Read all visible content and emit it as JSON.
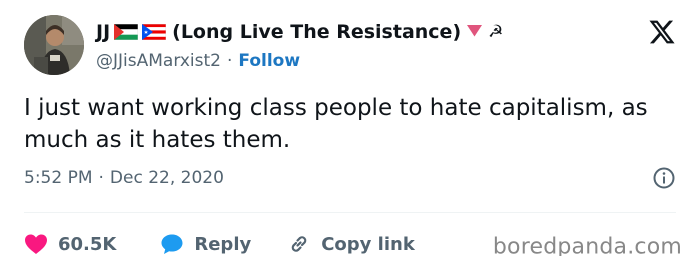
{
  "tweet": {
    "author": {
      "display_name_prefix": "JJ",
      "display_name_suffix": "(Long Live The Resistance)",
      "emoji_heart": "🔻",
      "emoji_symbol": "☭",
      "flags": [
        "palestine-flag-icon",
        "puerto-rico-flag-icon"
      ],
      "handle": "@JJisAMarxist2",
      "separator": "·",
      "follow_label": "Follow"
    },
    "text": "I just want working class people to hate capitalism, as much as it hates them.",
    "time": "5:52 PM",
    "meta_separator": "·",
    "date": "Dec 22, 2020",
    "actions": {
      "like_count": "60.5K",
      "reply_label": "Reply",
      "copy_link_label": "Copy link"
    }
  },
  "watermark": "boredpanda.com",
  "colors": {
    "text_primary": "#0f1419",
    "text_secondary": "#536471",
    "follow_blue": "#1d77c2",
    "like_red": "#f91880",
    "reply_blue": "#1d9bf0",
    "watermark_gray": "#888888"
  }
}
